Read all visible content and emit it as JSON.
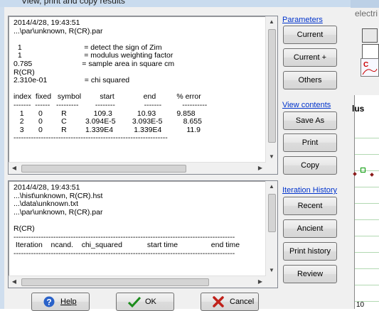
{
  "window": {
    "title": "View, print and copy results"
  },
  "background_app": {
    "title_fragment": "electri",
    "plot_label": "lus",
    "axis_label": "10"
  },
  "results_box": {
    "lines": [
      "2014/4/28, 19:43:51",
      "...\\par\\unknown, R(CR).par",
      "",
      "  1                              = detect the sign of Zim",
      "  1                              = modulus weighting factor",
      "0.785                        = sample area in square cm",
      "R(CR)",
      "2.310e-01                  = chi squared",
      "",
      "index  fixed   symbol         start              end          % error",
      "-------  ------   ---------        --------              -------          ----------",
      "   1       0         R             109.3            10.93          9.858",
      "   2       0         C         3.094E-5        3.093E-5          8.655",
      "   3       0         R         1.339E4          1.339E4            11.9",
      "--------------------------------------------------------------"
    ]
  },
  "history_box": {
    "lines": [
      "2014/4/28, 19:43:51",
      "...\\hist\\unknown, R(CR).hst",
      "...\\data\\unknown.txt",
      "...\\par\\unknown, R(CR).par",
      "",
      "R(CR)",
      "-----------------------------------------------------------------------------------------",
      " Iteration    ncand.    chi_squared            start time                end time",
      "-----------------------------------------------------------------------------------------"
    ]
  },
  "sidebar": {
    "parameters_link": "Parameters",
    "current": "Current",
    "current_plus": "Current +",
    "others": "Others",
    "view_contents_link": "View contents",
    "save_as": "Save As",
    "print": "Print",
    "copy": "Copy",
    "iteration_history_link": "Iteration History",
    "recent": "Recent",
    "ancient": "Ancient",
    "print_history": "Print history",
    "review": "Review"
  },
  "footer": {
    "help": "Help",
    "ok": "OK",
    "cancel": "Cancel"
  },
  "colors": {
    "link": "#0033cc",
    "ok_check": "#1c8c1c",
    "cancel_x": "#c0211a",
    "help_icon": "#2a62c9"
  }
}
